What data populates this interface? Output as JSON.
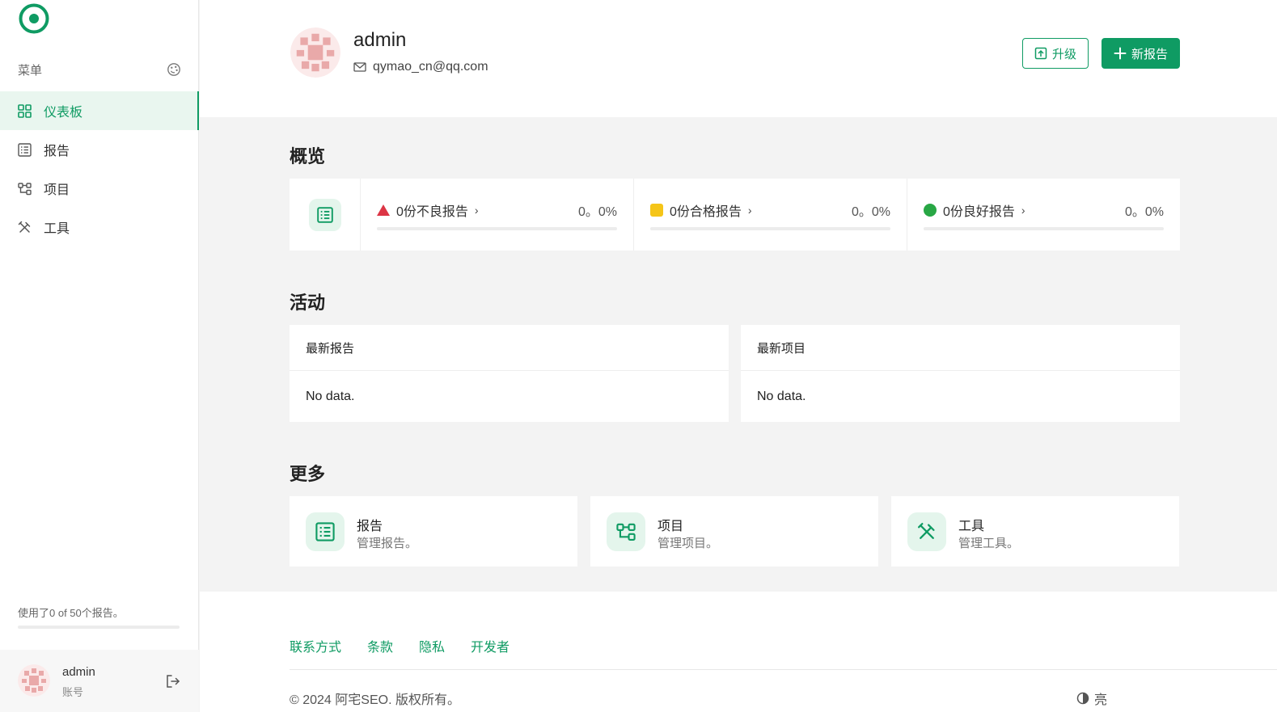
{
  "sidebar": {
    "menu_title": "菜单",
    "items": [
      {
        "label": "仪表板",
        "icon": "dashboard-grid-icon",
        "active": true
      },
      {
        "label": "报告",
        "icon": "report-list-icon"
      },
      {
        "label": "项目",
        "icon": "project-nodes-icon"
      },
      {
        "label": "工具",
        "icon": "tools-icon"
      }
    ],
    "usage_text": "使用了0 of 50个报告。",
    "usage_fraction": 0,
    "user": {
      "name": "admin",
      "subtitle": "账号"
    }
  },
  "header": {
    "name": "admin",
    "email": "qymao_cn@qq.com",
    "upgrade_label": "升级",
    "new_report_label": "新报告"
  },
  "overview": {
    "title": "概览",
    "stats": [
      {
        "label": "0份不良报告",
        "value": "0。0%",
        "indicator": "red-triangle",
        "color": "#dc3545"
      },
      {
        "label": "0份合格报告",
        "value": "0。0%",
        "indicator": "yellow-square",
        "color": "#f5c518"
      },
      {
        "label": "0份良好报告",
        "value": "0。0%",
        "indicator": "green-circle",
        "color": "#28a745"
      }
    ]
  },
  "activity": {
    "title": "活动",
    "cards": [
      {
        "title": "最新报告",
        "body": "No data."
      },
      {
        "title": "最新项目",
        "body": "No data."
      }
    ]
  },
  "more": {
    "title": "更多",
    "cards": [
      {
        "title": "报告",
        "desc": "管理报告。",
        "icon": "report-list-icon"
      },
      {
        "title": "项目",
        "desc": "管理项目。",
        "icon": "project-nodes-icon"
      },
      {
        "title": "工具",
        "desc": "管理工具。",
        "icon": "tools-icon"
      }
    ]
  },
  "footer": {
    "links": [
      "联系方式",
      "条款",
      "隐私",
      "开发者"
    ],
    "copyright": "© 2024 阿宅SEO. 版权所有。",
    "theme_label": "亮"
  },
  "colors": {
    "accent": "#0f9b63",
    "accent_light": "#e4f5ec"
  }
}
